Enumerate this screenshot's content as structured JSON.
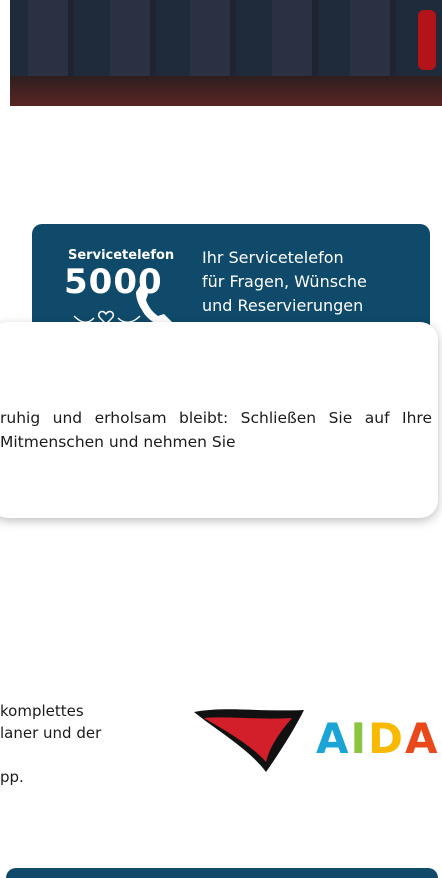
{
  "service_banner": {
    "kicker": "Servicetelefon",
    "number": "5000",
    "lines": [
      "Ihr Servicetelefon",
      "für Fragen, Wünsche",
      "und Reservierungen"
    ]
  },
  "card": {
    "text": "ruhig und erholsam bleibt: Schließen Sie auf Ihre Mitmenschen und nehmen Sie"
  },
  "text_block": {
    "line1": "komplettes",
    "line2": "laner und der",
    "line3": "pp."
  },
  "logo": {
    "letters": [
      "A",
      "I",
      "D",
      "A"
    ]
  }
}
